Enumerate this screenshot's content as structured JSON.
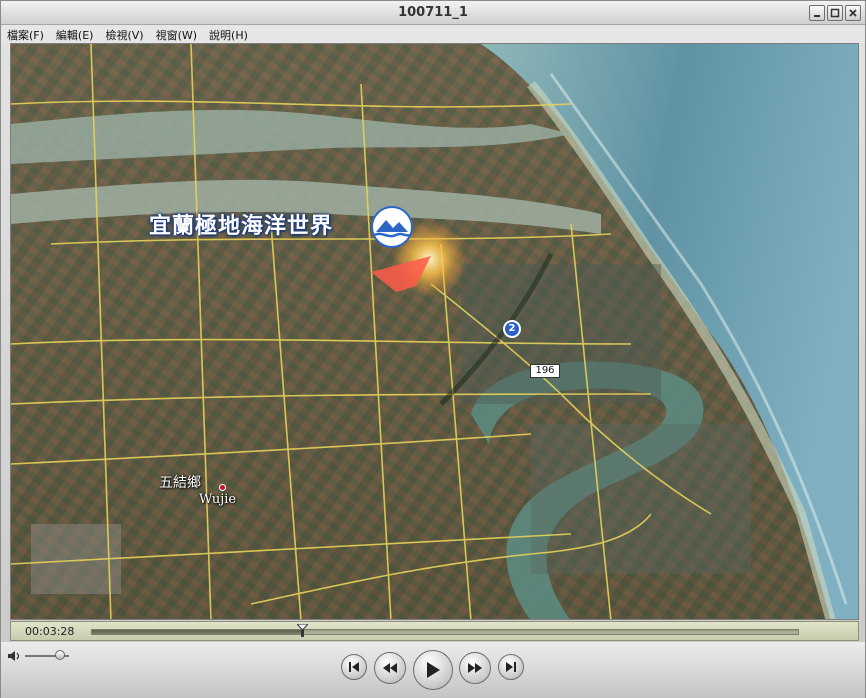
{
  "window": {
    "title": "100711_1"
  },
  "menu": [
    {
      "label": "檔案(F)"
    },
    {
      "label": "編輯(E)"
    },
    {
      "label": "檢視(V)"
    },
    {
      "label": "視窗(W)"
    },
    {
      "label": "說明(H)"
    }
  ],
  "video": {
    "overlay_label": "宜蘭極地海洋世界",
    "place_name_cn": "五結鄉",
    "place_name_en": "Wujie",
    "road_shield": "2",
    "road_sign": "196",
    "logo_icon": "ocean-world-logo-icon"
  },
  "playback": {
    "current_time": "00:03:28",
    "progress": 0.298,
    "volume": 0.8
  },
  "icons": {
    "minimize": "minimize-icon",
    "maximize": "maximize-icon",
    "close": "close-icon",
    "volume": "speaker-icon",
    "skip_back": "skip-to-start-icon",
    "rewind": "rewind-icon",
    "play": "play-icon",
    "fast_forward": "fast-forward-icon",
    "skip_forward": "skip-to-end-icon"
  },
  "colors": {
    "progress_bg": "#d6d8bd",
    "overlay_text_glow": "#1b3e8a",
    "marker": "#c8102e"
  }
}
